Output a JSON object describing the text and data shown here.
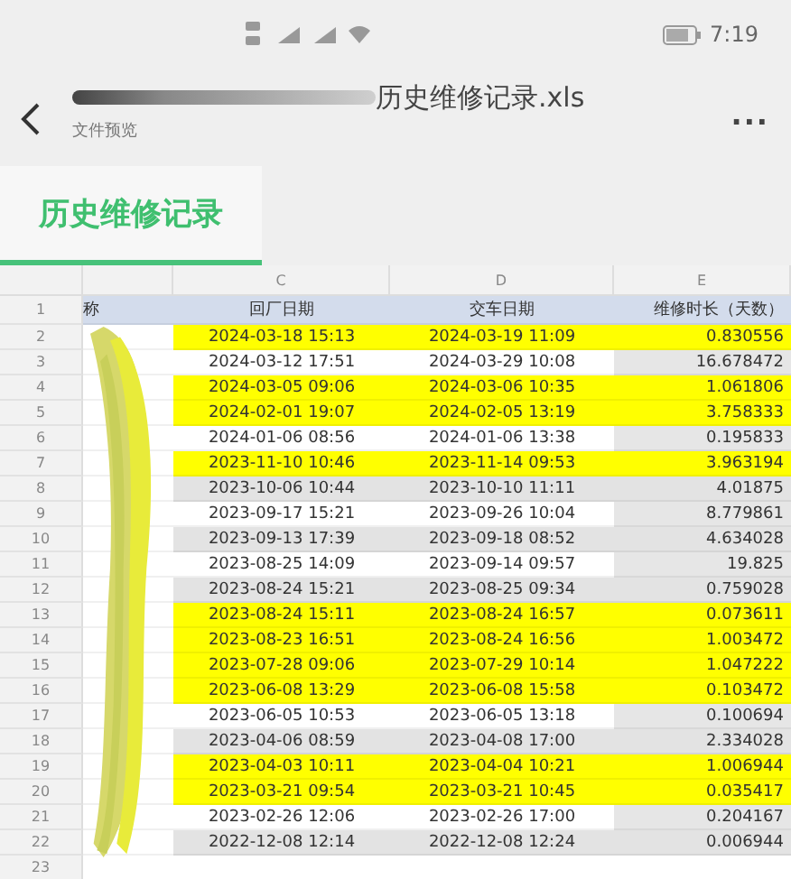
{
  "status_bar": {
    "time": "7:19"
  },
  "header": {
    "title": "历史维修记录.xls",
    "subtitle": "文件预览",
    "more": "..."
  },
  "sheet_tabs": [
    {
      "label": "历史维修记录",
      "selected": true
    }
  ],
  "sheet": {
    "column_letters": [
      "C",
      "D",
      "E"
    ],
    "header_row": {
      "number": "1",
      "cells": [
        "称",
        "回厂日期",
        "交车日期",
        "维修时长（天数）"
      ]
    },
    "rows": [
      {
        "number": "2",
        "kind": "highlighted",
        "cells": [
          "2024-03-18 15:13",
          "2024-03-19 11:09",
          "0.830556"
        ]
      },
      {
        "number": "3",
        "kind": "plain",
        "cells": [
          "2024-03-12 17:51",
          "2024-03-29 10:08",
          "16.678472"
        ]
      },
      {
        "number": "4",
        "kind": "highlighted",
        "cells": [
          "2024-03-05 09:06",
          "2024-03-06 10:35",
          "1.061806"
        ]
      },
      {
        "number": "5",
        "kind": "highlighted",
        "cells": [
          "2024-02-01 19:07",
          "2024-02-05 13:19",
          "3.758333"
        ]
      },
      {
        "number": "6",
        "kind": "plain",
        "cells": [
          "2024-01-06 08:56",
          "2024-01-06 13:38",
          "0.195833"
        ]
      },
      {
        "number": "7",
        "kind": "highlighted",
        "cells": [
          "2023-11-10 10:46",
          "2023-11-14 09:53",
          "3.963194"
        ]
      },
      {
        "number": "8",
        "kind": "shaded",
        "cells": [
          "2023-10-06 10:44",
          "2023-10-10 11:11",
          "4.01875"
        ]
      },
      {
        "number": "9",
        "kind": "plain",
        "cells": [
          "2023-09-17 15:21",
          "2023-09-26 10:04",
          "8.779861"
        ]
      },
      {
        "number": "10",
        "kind": "shaded",
        "cells": [
          "2023-09-13 17:39",
          "2023-09-18 08:52",
          "4.634028"
        ]
      },
      {
        "number": "11",
        "kind": "plain",
        "cells": [
          "2023-08-25 14:09",
          "2023-09-14 09:57",
          "19.825"
        ]
      },
      {
        "number": "12",
        "kind": "shaded",
        "cells": [
          "2023-08-24 15:21",
          "2023-08-25 09:34",
          "0.759028"
        ]
      },
      {
        "number": "13",
        "kind": "highlighted",
        "cells": [
          "2023-08-24 15:11",
          "2023-08-24 16:57",
          "0.073611"
        ]
      },
      {
        "number": "14",
        "kind": "highlighted",
        "cells": [
          "2023-08-23 16:51",
          "2023-08-24 16:56",
          "1.003472"
        ]
      },
      {
        "number": "15",
        "kind": "highlighted",
        "cells": [
          "2023-07-28 09:06",
          "2023-07-29 10:14",
          "1.047222"
        ]
      },
      {
        "number": "16",
        "kind": "highlighted",
        "cells": [
          "2023-06-08 13:29",
          "2023-06-08 15:58",
          "0.103472"
        ]
      },
      {
        "number": "17",
        "kind": "plain",
        "cells": [
          "2023-06-05 10:53",
          "2023-06-05 13:18",
          "0.100694"
        ]
      },
      {
        "number": "18",
        "kind": "shaded",
        "cells": [
          "2023-04-06 08:59",
          "2023-04-08 17:00",
          "2.334028"
        ]
      },
      {
        "number": "19",
        "kind": "highlighted",
        "cells": [
          "2023-04-03 10:11",
          "2023-04-04 10:21",
          "1.006944"
        ]
      },
      {
        "number": "20",
        "kind": "highlighted",
        "cells": [
          "2023-03-21 09:54",
          "2023-03-21 10:45",
          "0.035417"
        ]
      },
      {
        "number": "21",
        "kind": "plain",
        "cells": [
          "2023-02-26 12:06",
          "2023-02-26 17:00",
          "0.204167"
        ]
      },
      {
        "number": "22",
        "kind": "shaded",
        "cells": [
          "2022-12-08 12:14",
          "2022-12-08 12:24",
          "0.006944"
        ]
      },
      {
        "number": "23",
        "kind": "empty"
      }
    ]
  }
}
